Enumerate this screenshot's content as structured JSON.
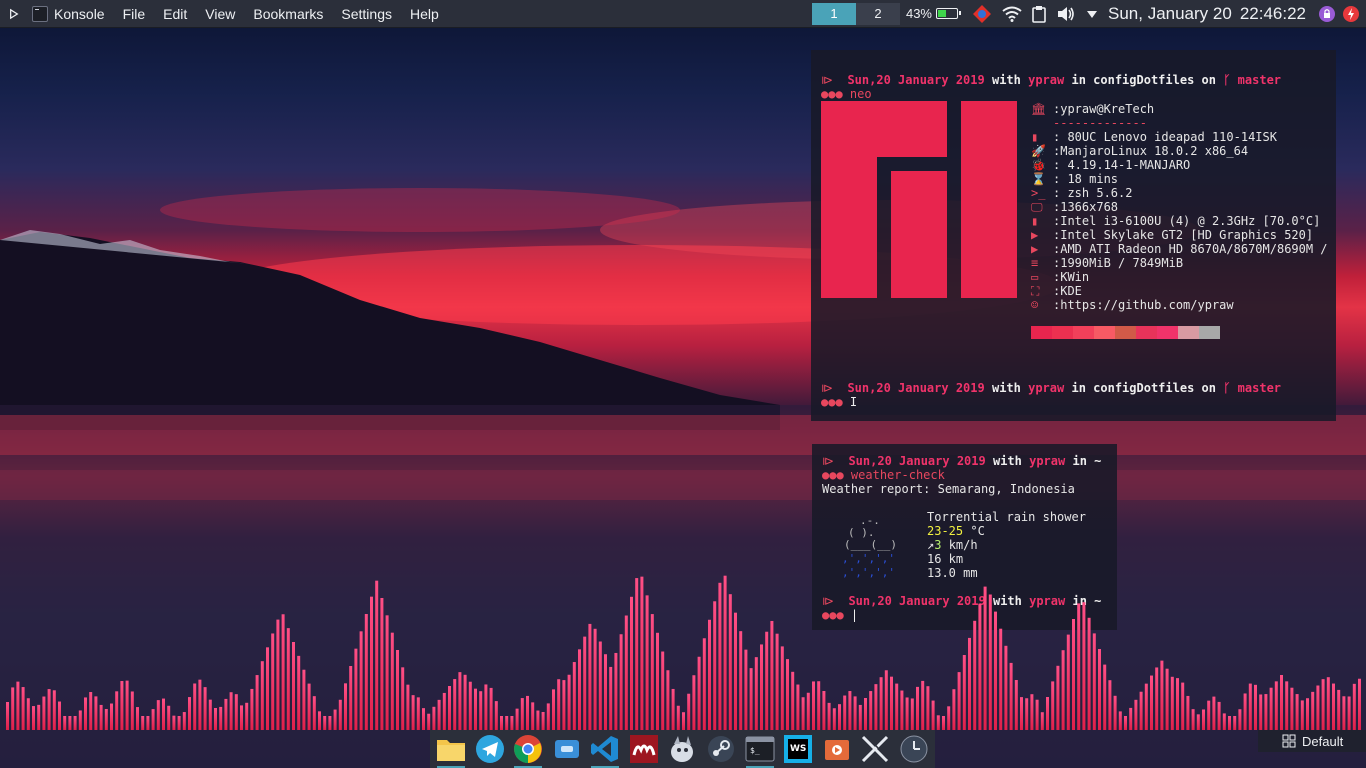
{
  "top_panel": {
    "app_name": "Konsole",
    "menu": [
      "File",
      "Edit",
      "View",
      "Bookmarks",
      "Settings",
      "Help"
    ],
    "pager": [
      "1",
      "2"
    ],
    "battery_percent": "43%",
    "battery_level": 0.43,
    "date": "Sun, January 20",
    "time": "22:46:22"
  },
  "terminal1": {
    "prompt1": {
      "date": "Sun,20 January 2019",
      "with": "with",
      "user": "ypraw",
      "in": "in",
      "dir": "configDotfiles",
      "on": "on",
      "branch_icon": "ᚴ",
      "branch": "master"
    },
    "command": "neo",
    "prompt_marker": "⧐",
    "dots": "●●●",
    "info": [
      {
        "icon": "🏛",
        "value": ":ypraw@KreTech"
      },
      {
        "icon": "",
        "value": "-------------"
      },
      {
        "icon": "▮",
        "value": ": 80UC Lenovo ideapad 110-14ISK"
      },
      {
        "icon": "🚀",
        "value": ":ManjaroLinux 18.0.2 x86_64"
      },
      {
        "icon": "🐞",
        "value": ": 4.19.14-1-MANJARO"
      },
      {
        "icon": "⌛",
        "value": ": 18 mins"
      },
      {
        "icon": ">_",
        "value": ": zsh 5.6.2"
      },
      {
        "icon": "🖵",
        "value": ":1366x768"
      },
      {
        "icon": "▮",
        "value": ":Intel i3-6100U (4) @ 2.3GHz [70.0°C]"
      },
      {
        "icon": "▶",
        "value": ":Intel Skylake GT2 [HD Graphics 520]"
      },
      {
        "icon": "▶",
        "value": ":AMD ATI Radeon HD 8670A/8670M/8690M /"
      },
      {
        "icon": "≡",
        "value": ":1990MiB / 7849MiB"
      },
      {
        "icon": "▭",
        "value": ":KWin"
      },
      {
        "icon": "⛶",
        "value": ":KDE"
      },
      {
        "icon": "☺",
        "value": ":https://github.com/ypraw"
      }
    ],
    "swatch_colors": [
      "#e8254e",
      "#ec3050",
      "#f2405a",
      "#f75a64",
      "#d15a48",
      "#e8335a",
      "#f0336a",
      "#d89aa2",
      "#a8a8a8"
    ],
    "prompt2": {
      "date": "Sun,20 January 2019",
      "with": "with",
      "user": "ypraw",
      "in": "in",
      "dir": "configDotfiles",
      "on": "on",
      "branch_icon": "ᚴ",
      "branch": "master"
    }
  },
  "terminal2": {
    "prompt1": {
      "date": "Sun,20 January 2019",
      "with": "with",
      "user": "ypraw",
      "in": "in",
      "dir": "~"
    },
    "command": "weather-check",
    "report": "Weather report: Semarang, Indonesia",
    "condition": "Torrential rain shower",
    "temp": "23-25",
    "temp_unit": " °C",
    "wind_arrow": "↗",
    "wind_speed": "3",
    "wind_unit": " km/h",
    "visibility": "16 km",
    "precip": "13.0 mm",
    "prompt2": {
      "date": "Sun,20 January 2019",
      "with": "with",
      "user": "ypraw",
      "in": "in",
      "dir": "~"
    }
  },
  "dock": {
    "icons": [
      "folder-icon",
      "telegram-icon",
      "chrome-icon",
      "virtualbox-icon",
      "vscode-icon",
      "mendeley-icon",
      "gimp-icon",
      "steam-icon",
      "terminal-icon",
      "webstorm-icon",
      "media-icon",
      "x-icon",
      "clock-icon"
    ]
  },
  "layout_indicator": "Default",
  "colors": {
    "accent": "#f0336a",
    "panel": "#2b2f3a",
    "pager_active": "#4aa3b8"
  }
}
